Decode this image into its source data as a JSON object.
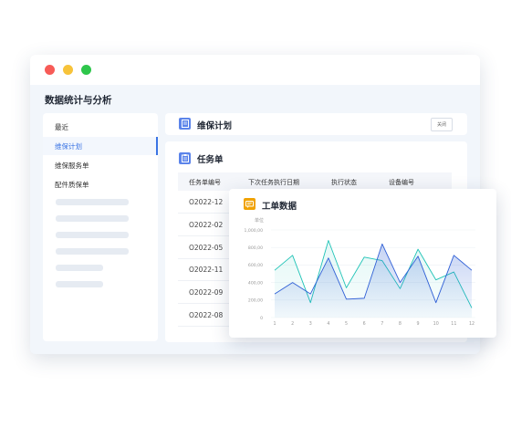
{
  "app": {
    "title": "数据统计与分析"
  },
  "sidebar": {
    "items": [
      {
        "label": "最近"
      },
      {
        "label": "维保计划",
        "active": true
      },
      {
        "label": "维保服务单"
      },
      {
        "label": "配件质保单"
      }
    ]
  },
  "plan_panel": {
    "title": "维保计划",
    "close_label": "关闭"
  },
  "task_panel": {
    "title": "任务单",
    "columns": [
      "任务单编号",
      "下次任务执行日期",
      "执行状态",
      "设备编号"
    ],
    "rows": [
      "O2022-12",
      "O2022-02",
      "O2022-05",
      "O2022-11",
      "O2022-09",
      "O2022-08"
    ]
  },
  "chart_card": {
    "title": "工单数据"
  },
  "chart_data": {
    "type": "area",
    "title": "工单数据",
    "ylabel": "单位",
    "x": [
      1,
      2,
      3,
      4,
      5,
      6,
      7,
      8,
      9,
      10,
      11,
      12
    ],
    "yticks": [
      "0",
      "200,00",
      "400,00",
      "600,00",
      "800,00",
      "1,000,00"
    ],
    "ylim": [
      0,
      1000
    ],
    "grid": true,
    "series": [
      {
        "values": [
          270,
          400,
          270,
          680,
          210,
          220,
          840,
          400,
          700,
          170,
          710,
          540
        ],
        "color": "#2f5fd6"
      },
      {
        "values": [
          540,
          710,
          170,
          880,
          340,
          690,
          650,
          330,
          780,
          430,
          520,
          110
        ],
        "color": "#1fc3b6"
      }
    ]
  },
  "colors": {
    "accent": "#3a74e4",
    "chart_icon": "#f0a202"
  }
}
